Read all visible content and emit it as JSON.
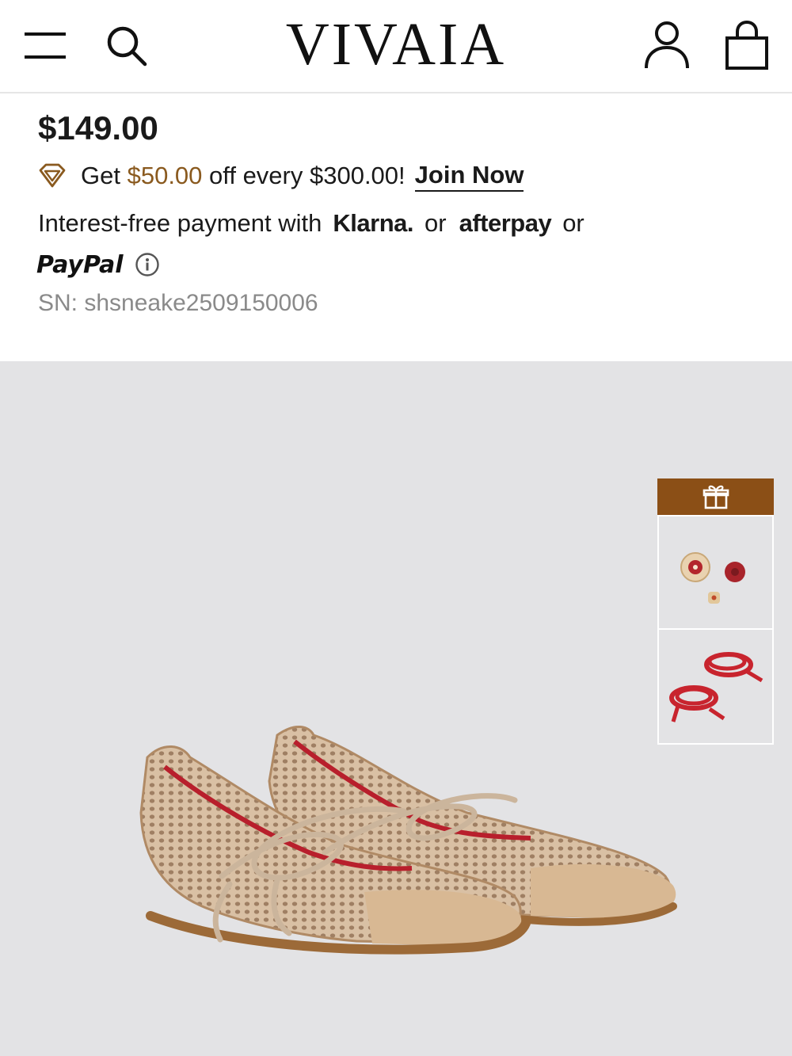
{
  "header": {
    "logo": "VIVAIA",
    "icons": {
      "menu": "hamburger-menu-icon",
      "search": "search-icon",
      "account": "user-account-icon",
      "bag": "shopping-bag-icon"
    }
  },
  "product": {
    "price": "$149.00",
    "promo": {
      "prefix": "Get",
      "amount": "$50.00",
      "suffix": "off every $300.00!",
      "link_label": "Join Now",
      "icon": "diamond-icon"
    },
    "payment": {
      "prefix": "Interest-free payment with",
      "klarna": "Klarna.",
      "or1": "or",
      "afterpay": "afterpay",
      "or2": "or",
      "paypal": "PayPal",
      "info_icon": "info-icon"
    },
    "sn": "SN: shsneake2509150006"
  },
  "gift_panel": {
    "icon": "gift-icon",
    "thumbnails": [
      "shoe-charms",
      "red-shoelaces"
    ]
  },
  "colors": {
    "accent_brown": "#8b4f16",
    "promo_amount": "#8a5a1f",
    "image_bg": "#e3e3e5",
    "sn_gray": "#8a8a8a"
  }
}
